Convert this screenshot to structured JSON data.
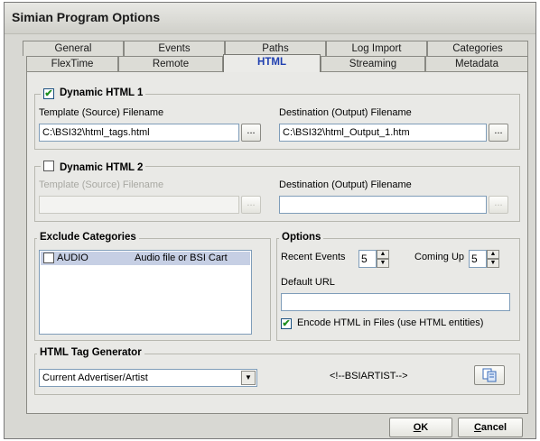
{
  "window": {
    "title": "Simian Program Options"
  },
  "tabs_row1": [
    "General",
    "Events",
    "Paths",
    "Log Import",
    "Categories"
  ],
  "tabs_row2": [
    "FlexTime",
    "Remote",
    "HTML",
    "Streaming",
    "Metadata"
  ],
  "active_tab": "HTML",
  "dynamic1": {
    "label": "Dynamic HTML 1",
    "checked": "✔",
    "template_label": "Template (Source) Filename",
    "template_value": "C:\\BSI32\\html_tags.html",
    "dest_label": "Destination (Output) Filename",
    "dest_value": "C:\\BSI32\\html_Output_1.htm",
    "browse": "..."
  },
  "dynamic2": {
    "label": "Dynamic HTML 2",
    "template_label": "Template (Source) Filename",
    "template_value": "",
    "dest_label": "Destination (Output) Filename",
    "dest_value": "",
    "browse": "..."
  },
  "exclude": {
    "title": "Exclude Categories",
    "items": [
      {
        "code": "AUDIO",
        "desc": "Audio file or BSI Cart"
      }
    ]
  },
  "options": {
    "title": "Options",
    "recent_events_label": "Recent Events",
    "recent_events_value": "5",
    "coming_up_label": "Coming Up",
    "coming_up_value": "5",
    "default_url_label": "Default URL",
    "default_url_value": "",
    "encode_label": "Encode HTML in Files (use HTML entities)",
    "encode_checked": "✔"
  },
  "tag_generator": {
    "title": "HTML Tag Generator",
    "selected": "Current Advertiser/Artist",
    "tag": "<!--BSIARTIST-->"
  },
  "buttons": {
    "ok_u": "O",
    "ok_rest": "K",
    "cancel_u": "C",
    "cancel_rest": "ancel"
  },
  "colors": {
    "active_tab": "#1f3fb0",
    "check": "#1f8f1f"
  }
}
